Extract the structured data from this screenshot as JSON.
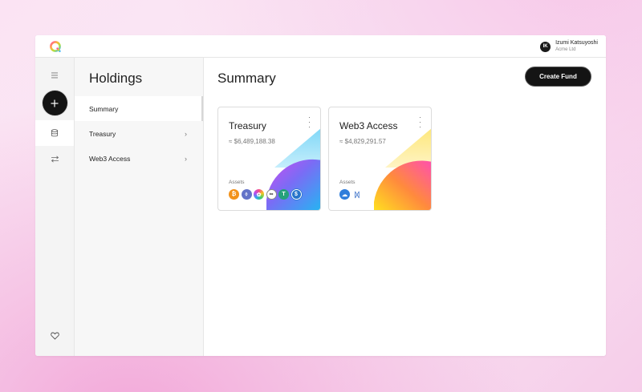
{
  "user": {
    "initials": "IK",
    "name": "Izumi Katsuyoshi",
    "org": "Acme Ltd"
  },
  "rail": {
    "menu_icon": "hamburger-icon",
    "add_icon": "plus-icon",
    "holdings_icon": "database-icon",
    "transfer_icon": "swap-arrows-icon",
    "favorites_icon": "heart-icon"
  },
  "nav": {
    "title": "Holdings",
    "items": [
      {
        "label": "Summary",
        "active": true,
        "has_chevron": false
      },
      {
        "label": "Treasury",
        "active": false,
        "has_chevron": true
      },
      {
        "label": "Web3 Access",
        "active": false,
        "has_chevron": true
      }
    ],
    "chevron": "›"
  },
  "main": {
    "title": "Summary",
    "create_button": "Create Fund"
  },
  "cards": [
    {
      "title": "Treasury",
      "value": "≈ $6,489,188.38",
      "assets_label": "Assets",
      "assets": [
        {
          "name": "bitcoin-icon",
          "glyph": "₿",
          "color": "#f2921b"
        },
        {
          "name": "ethereum-icon",
          "glyph": "⬨",
          "color": "#6272c8"
        },
        {
          "name": "pinwheel-token-icon",
          "glyph": "✿",
          "color": "#e8c21a"
        },
        {
          "name": "chain-link-token-icon",
          "glyph": "∞",
          "color": "#ffffff"
        },
        {
          "name": "tether-icon",
          "glyph": "T",
          "color": "#26a17b"
        },
        {
          "name": "usd-coin-icon",
          "glyph": "$",
          "color": "#2775ca"
        }
      ]
    },
    {
      "title": "Web3 Access",
      "value": "≈ $4,829,291.57",
      "assets_label": "Assets",
      "assets": [
        {
          "name": "cloud-token-icon",
          "glyph": "☁",
          "color": "#2f7ddb"
        },
        {
          "name": "butterfly-token-icon",
          "glyph": "ᛞ",
          "color": "#3a70c8"
        }
      ]
    }
  ]
}
